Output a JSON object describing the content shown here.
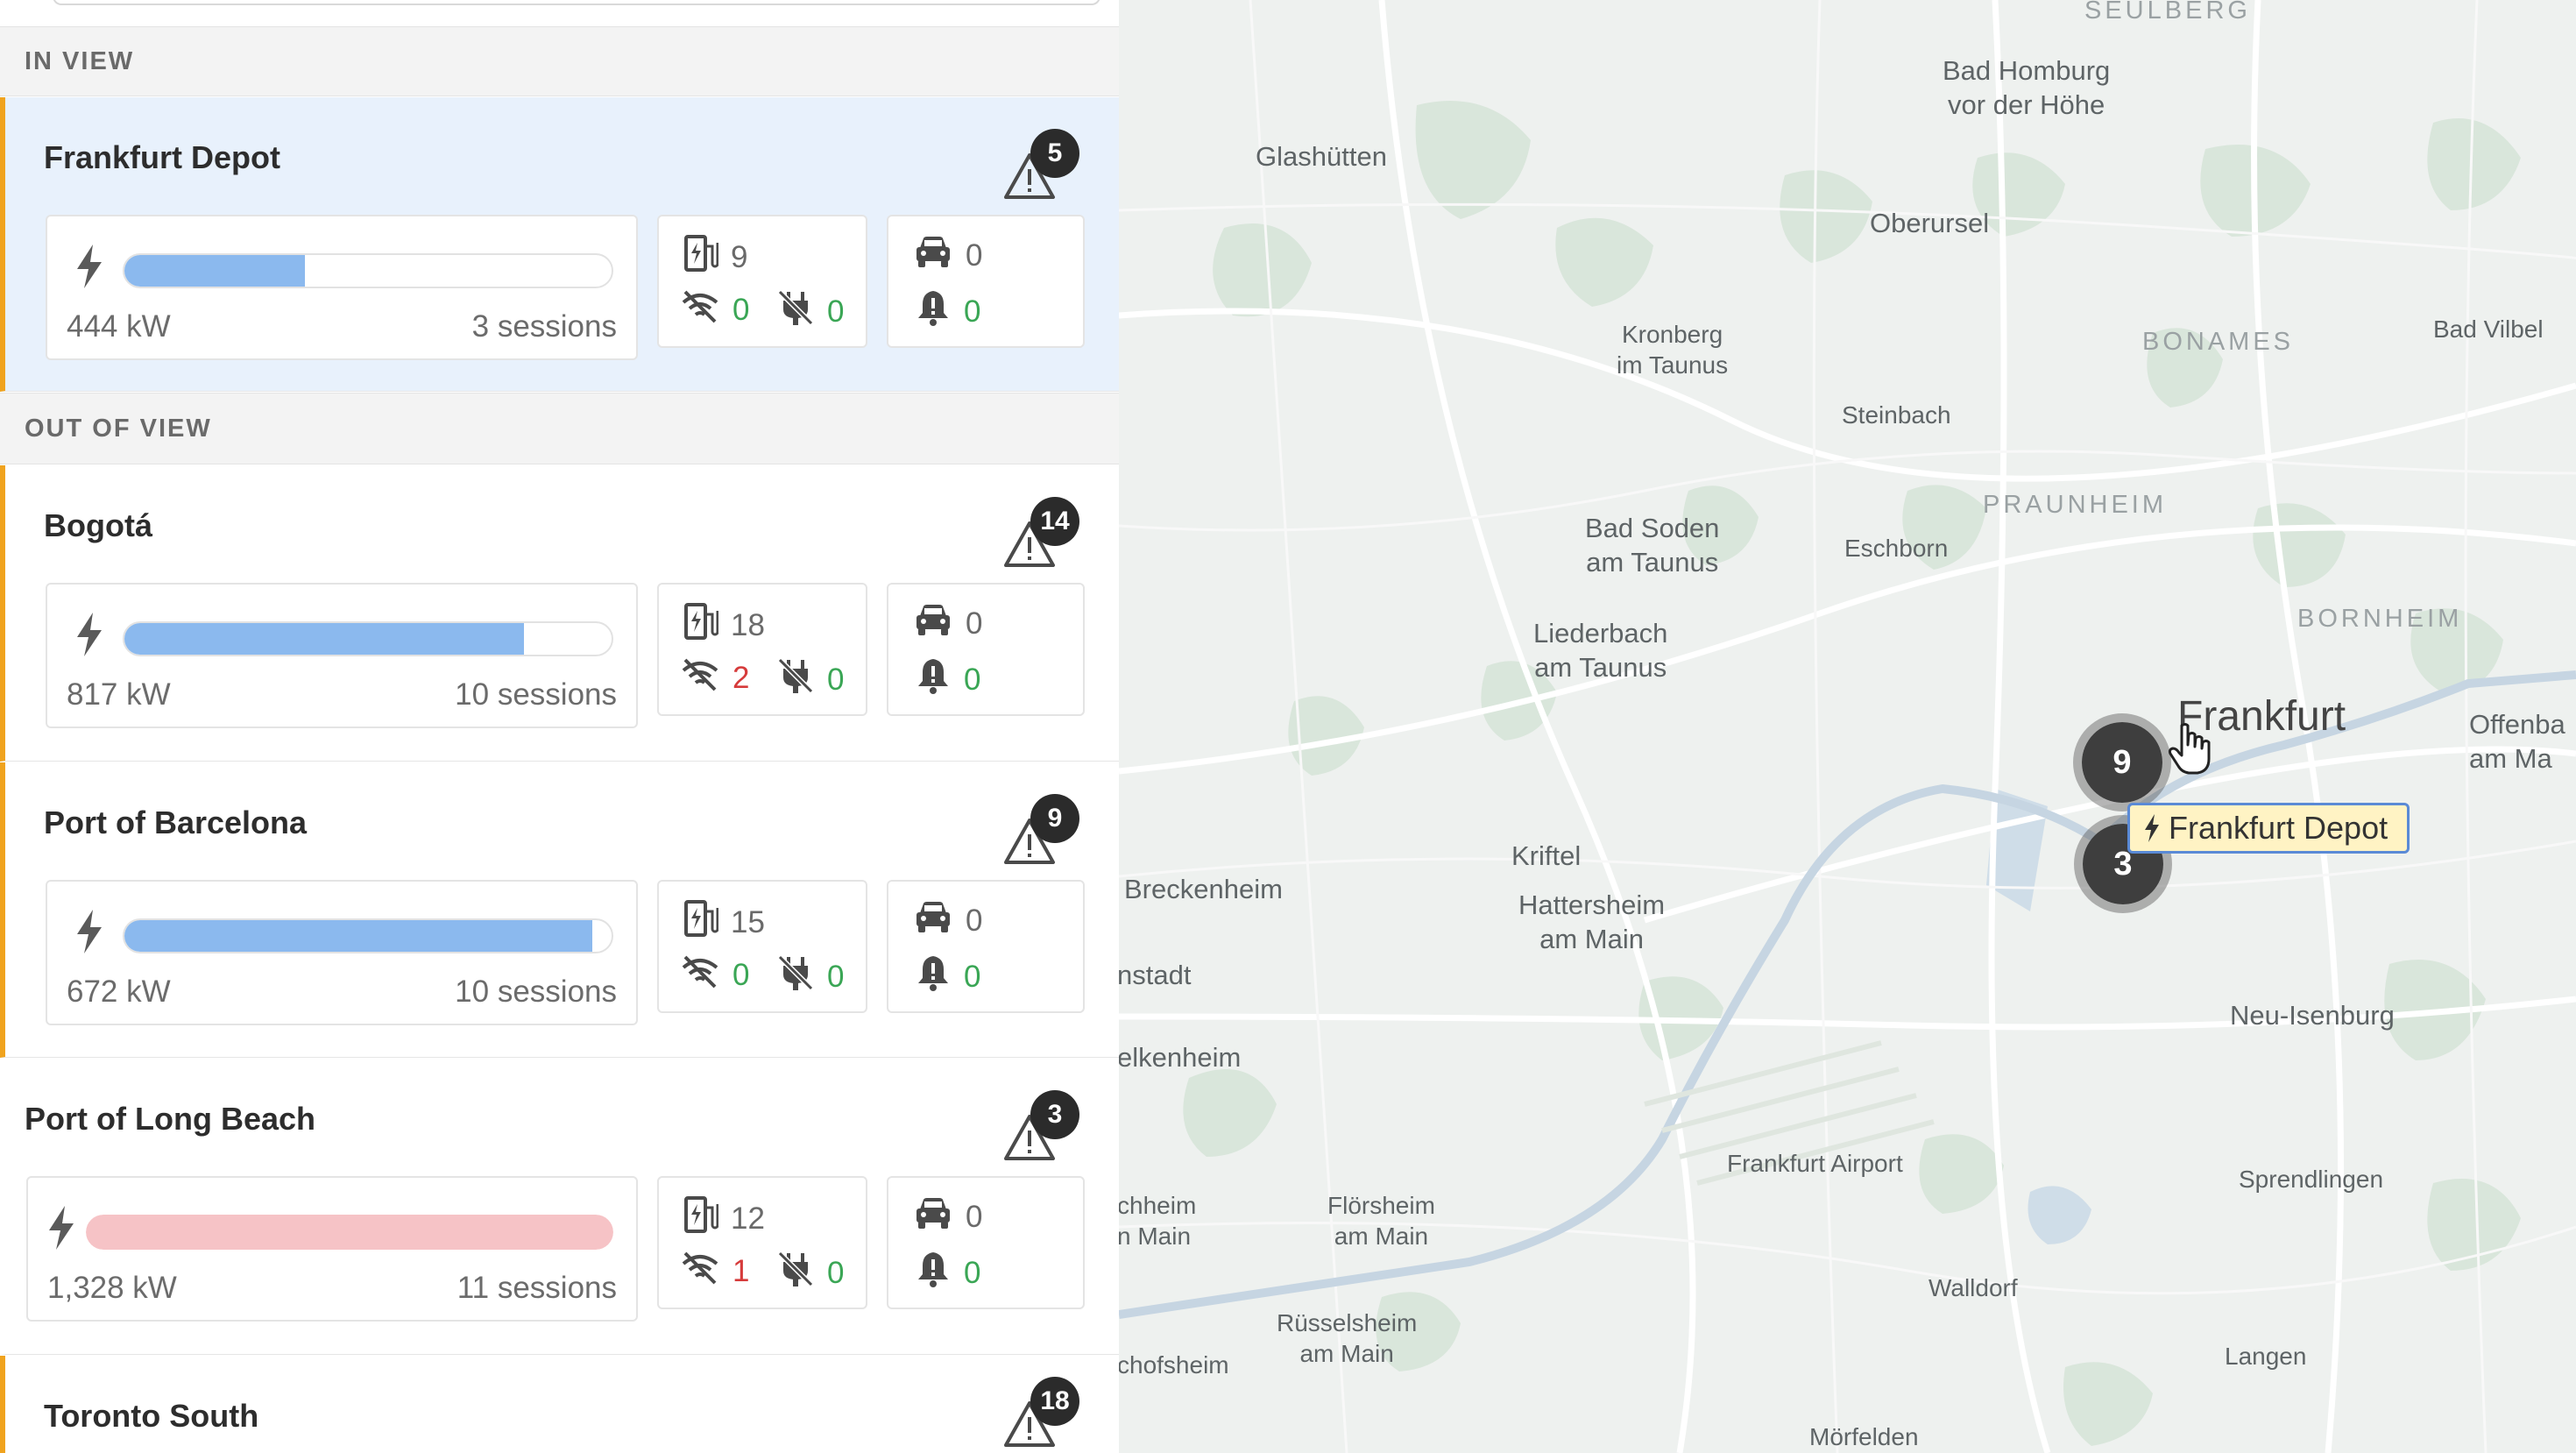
{
  "sidebar": {
    "in_view_header": "IN VIEW",
    "out_of_view_header": "OUT OF VIEW",
    "sites": [
      {
        "name": "Frankfurt Depot",
        "alerts": "5",
        "power_kw": "444 kW",
        "sessions": "3 sessions",
        "capacity_fraction": 0.37,
        "status": "normal",
        "chargers": "9",
        "offline": "0",
        "faulted": "0",
        "vehicles": "0",
        "vehicle_alerts": "0"
      },
      {
        "name": "Bogotá",
        "alerts": "14",
        "power_kw": "817 kW",
        "sessions": "10 sessions",
        "capacity_fraction": 0.82,
        "status": "normal",
        "chargers": "18",
        "offline": "2",
        "faulted": "0",
        "vehicles": "0",
        "vehicle_alerts": "0"
      },
      {
        "name": "Port of Barcelona",
        "alerts": "9",
        "power_kw": "672 kW",
        "sessions": "10 sessions",
        "capacity_fraction": 0.96,
        "status": "normal",
        "chargers": "15",
        "offline": "0",
        "faulted": "0",
        "vehicles": "0",
        "vehicle_alerts": "0"
      },
      {
        "name": "Port of Long Beach",
        "alerts": "3",
        "power_kw": "1,328 kW",
        "sessions": "11 sessions",
        "capacity_fraction": 1.0,
        "status": "critical",
        "chargers": "12",
        "offline": "1",
        "faulted": "0",
        "vehicles": "0",
        "vehicle_alerts": "0"
      },
      {
        "name": "Toronto South",
        "alerts": "18"
      }
    ]
  },
  "map": {
    "labels": {
      "seulberg": "SEULBERG",
      "bad_homburg": "Bad Homburg\nvor der Höhe",
      "glashutten": "Glashütten",
      "oberursel": "Oberursel",
      "kronberg": "Kronberg\nim Taunus",
      "bonames": "BONAMES",
      "bad_vilbel": "Bad Vilbel",
      "steinbach": "Steinbach",
      "praunheim": "PRAUNHEIM",
      "bad_soden": "Bad Soden\nam Taunus",
      "eschborn": "Eschborn",
      "liederbach": "Liederbach\nam Taunus",
      "bornheim": "BORNHEIM",
      "frankfurt": "Frankfurt",
      "offenbach": "Offenba\nam Ma",
      "kriftel": "Kriftel",
      "breckenheim": "Breckenheim",
      "hattersheim": "Hattersheim\nam Main",
      "nstadt": "nstadt",
      "neu_isenburg": "Neu-Isenburg",
      "elkenheim": "elkenheim",
      "airport": "Frankfurt Airport",
      "sprendlingen": "Sprendlingen",
      "chheim": "chheim\nn Main",
      "florsheim": "Flörsheim\nam Main",
      "walldorf": "Walldorf",
      "russelsheim": "Rüsselsheim\nam Main",
      "chofsheim": "chofsheim",
      "langen": "Langen",
      "morfelden": "Mörfelden"
    },
    "clusters": {
      "upper": "9",
      "lower": "3"
    },
    "tooltip": "Frankfurt Depot"
  },
  "colors": {
    "accent": "#f0a31e",
    "bar": "#8bb9ee",
    "bar_critical": "#f6c3c6",
    "good": "#3aa655",
    "bad": "#d63b3b",
    "tooltip_bg": "#fff3c4",
    "tooltip_border": "#5a8ad6"
  }
}
